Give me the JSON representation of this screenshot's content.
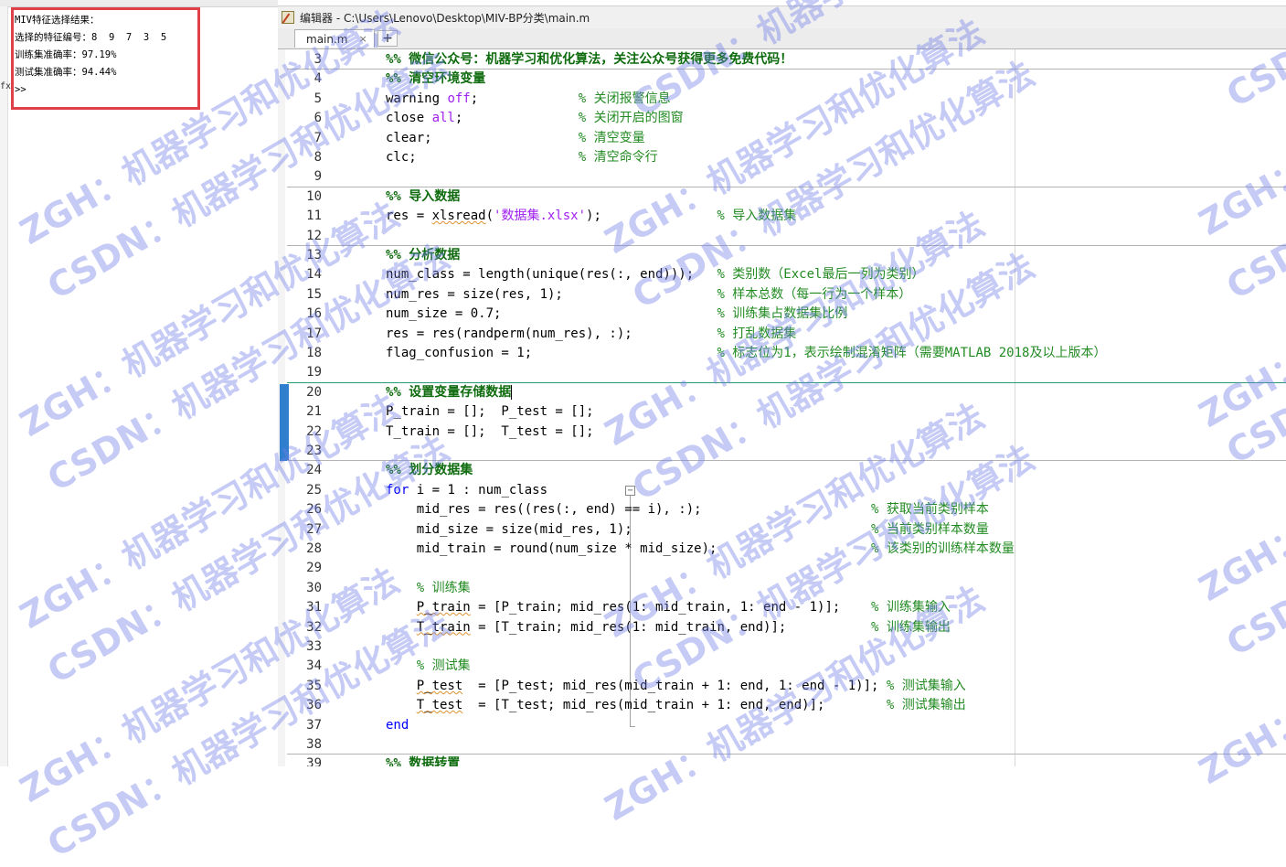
{
  "command_window": {
    "output_lines": [
      "MIV特征选择结果：",
      "选择的特征编号：8  9  7  3  5",
      "训练集准确率：97.19%",
      "测试集准确率：94.44%",
      ">>"
    ],
    "fx_glyph": "fx"
  },
  "editor": {
    "title": "编辑器 - C:\\Users\\Lenovo\\Desktop\\MIV-BP分类\\main.m",
    "tab_label": "main.m",
    "tab_close": "×",
    "add_tab": "+",
    "fold_glyph": "−",
    "lines": [
      {
        "n": "3",
        "seg": [
          [
            "cell",
            "%% 微信公众号：机器学习和优化算法，关注公众号获得更多免费代码！"
          ]
        ]
      },
      {
        "n": "4",
        "seg": [
          [
            "cell",
            "%% 清空环境变量"
          ]
        ]
      },
      {
        "n": "5",
        "seg": [
          [
            "",
            "warning "
          ],
          [
            "str",
            "off"
          ],
          [
            "",
            ";             "
          ],
          [
            "cm",
            "% 关闭报警信息"
          ]
        ]
      },
      {
        "n": "6",
        "seg": [
          [
            "",
            "close "
          ],
          [
            "str",
            "all"
          ],
          [
            "",
            ";               "
          ],
          [
            "cm",
            "% 关闭开启的图窗"
          ]
        ]
      },
      {
        "n": "7",
        "seg": [
          [
            "",
            "clear;                   "
          ],
          [
            "cm",
            "% 清空变量"
          ]
        ]
      },
      {
        "n": "8",
        "seg": [
          [
            "",
            "clc;                     "
          ],
          [
            "cm",
            "% 清空命令行"
          ]
        ]
      },
      {
        "n": "9",
        "seg": []
      },
      {
        "n": "10",
        "seg": [
          [
            "cell",
            "%% 导入数据"
          ]
        ]
      },
      {
        "n": "11",
        "seg": [
          [
            "",
            "res = "
          ],
          [
            "warn",
            "xlsread"
          ],
          [
            "",
            "("
          ],
          [
            "str",
            "'数据集.xlsx'"
          ],
          [
            "",
            ");               "
          ],
          [
            "cm",
            "% 导入数据集"
          ]
        ]
      },
      {
        "n": "12",
        "seg": []
      },
      {
        "n": "13",
        "seg": [
          [
            "cell",
            "%% 分析数据"
          ]
        ]
      },
      {
        "n": "14",
        "seg": [
          [
            "",
            "num_class = length(unique(res(:, end)));   "
          ],
          [
            "cm",
            "% 类别数（Excel最后一列为类别）"
          ]
        ]
      },
      {
        "n": "15",
        "seg": [
          [
            "",
            "num_res = size(res, 1);                    "
          ],
          [
            "cm",
            "% 样本总数（每一行为一个样本）"
          ]
        ]
      },
      {
        "n": "16",
        "seg": [
          [
            "",
            "num_size = 0.7;                            "
          ],
          [
            "cm",
            "% 训练集占数据集比例"
          ]
        ]
      },
      {
        "n": "17",
        "seg": [
          [
            "",
            "res = res(randperm(num_res), :);           "
          ],
          [
            "cm",
            "% 打乱数据集"
          ]
        ]
      },
      {
        "n": "18",
        "seg": [
          [
            "",
            "flag_confusion = 1;                        "
          ],
          [
            "cm",
            "% 标志位为1，表示绘制混淆矩阵（需要MATLAB 2018及以上版本）"
          ]
        ]
      },
      {
        "n": "19",
        "seg": []
      },
      {
        "n": "20",
        "seg": [
          [
            "cell",
            "%% 设置变量存储数据"
          ]
        ]
      },
      {
        "n": "21",
        "seg": [
          [
            "",
            "P_train = [];  P_test = [];"
          ]
        ]
      },
      {
        "n": "22",
        "seg": [
          [
            "",
            "T_train = [];  T_test = [];"
          ]
        ]
      },
      {
        "n": "23",
        "seg": []
      },
      {
        "n": "24",
        "seg": [
          [
            "cell",
            "%% 划分数据集"
          ]
        ]
      },
      {
        "n": "25",
        "seg": [
          [
            "kw",
            "for"
          ],
          [
            "",
            " i = 1 : num_class"
          ]
        ]
      },
      {
        "n": "26",
        "seg": [
          [
            "",
            "    mid_res = res((res(:, end) == i), :);                      "
          ],
          [
            "cm",
            "% 获取当前类别样本"
          ]
        ]
      },
      {
        "n": "27",
        "seg": [
          [
            "",
            "    mid_size = size(mid_res, 1);                               "
          ],
          [
            "cm",
            "% 当前类别样本数量"
          ]
        ]
      },
      {
        "n": "28",
        "seg": [
          [
            "",
            "    mid_train = round(num_size * mid_size);                    "
          ],
          [
            "cm",
            "% 该类别的训练样本数量"
          ]
        ]
      },
      {
        "n": "29",
        "seg": []
      },
      {
        "n": "30",
        "seg": [
          [
            "",
            "    "
          ],
          [
            "cm",
            "% 训练集"
          ]
        ]
      },
      {
        "n": "31",
        "seg": [
          [
            "",
            "    "
          ],
          [
            "warn",
            "P_train"
          ],
          [
            "",
            " = [P_train; mid_res(1: mid_train, 1: end - 1)];    "
          ],
          [
            "cm",
            "% 训练集输入"
          ]
        ]
      },
      {
        "n": "32",
        "seg": [
          [
            "",
            "    "
          ],
          [
            "warn",
            "T_train"
          ],
          [
            "",
            " = [T_train; mid_res(1: mid_train, end)];           "
          ],
          [
            "cm",
            "% 训练集输出"
          ]
        ]
      },
      {
        "n": "33",
        "seg": []
      },
      {
        "n": "34",
        "seg": [
          [
            "",
            "    "
          ],
          [
            "cm",
            "% 测试集"
          ]
        ]
      },
      {
        "n": "35",
        "seg": [
          [
            "",
            "    "
          ],
          [
            "warn",
            "P_test"
          ],
          [
            "",
            "  = [P_test; mid_res(mid_train + 1: end, 1: end - 1)]; "
          ],
          [
            "cm",
            "% 测试集输入"
          ]
        ]
      },
      {
        "n": "36",
        "seg": [
          [
            "",
            "    "
          ],
          [
            "warn",
            "T_test"
          ],
          [
            "",
            "  = [T_test; mid_res(mid_train + 1: end, end)];        "
          ],
          [
            "cm",
            "% 测试集输出"
          ]
        ]
      },
      {
        "n": "37",
        "seg": [
          [
            "kw",
            "end"
          ]
        ]
      },
      {
        "n": "38",
        "seg": []
      },
      {
        "n": "39",
        "seg": [
          [
            "cell",
            "%% 数据转置"
          ]
        ]
      }
    ]
  },
  "watermark": {
    "zgh": "ZGH：机器学习和优化算法",
    "csdn": "CSDN：机器学习和优化算法"
  },
  "colors": {
    "comment": "#228b22",
    "cell_title": "#0e6b0e",
    "keyword": "#0000ff",
    "string": "#a020f0",
    "highlight_box": "#e0404a",
    "modified_bar": "#2f7fce"
  }
}
